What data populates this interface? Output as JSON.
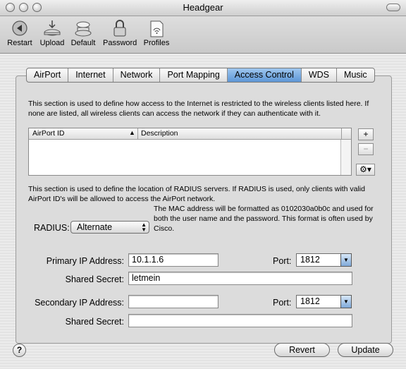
{
  "window": {
    "title": "Headgear"
  },
  "toolbar": {
    "items": [
      {
        "label": "Restart",
        "icon": "restart-icon"
      },
      {
        "label": "Upload",
        "icon": "upload-icon"
      },
      {
        "label": "Default",
        "icon": "default-icon"
      },
      {
        "label": "Password",
        "icon": "lock-icon"
      },
      {
        "label": "Profiles",
        "icon": "profiles-icon"
      }
    ]
  },
  "tabs": [
    {
      "label": "AirPort"
    },
    {
      "label": "Internet"
    },
    {
      "label": "Network"
    },
    {
      "label": "Port Mapping"
    },
    {
      "label": "Access Control",
      "active": true
    },
    {
      "label": "WDS"
    },
    {
      "label": "Music"
    }
  ],
  "access_control": {
    "description": "This section is used to define how access to the Internet is restricted to the wireless clients listed here. If none are listed, all wireless clients can access the network if they can authenticate with it.",
    "table": {
      "columns": [
        "AirPort ID",
        "Description"
      ],
      "rows": []
    },
    "add_label": "+",
    "remove_label": "−",
    "action_icon": "gear-icon"
  },
  "radius": {
    "description": "This section is used to define the location of RADIUS servers. If RADIUS is used, only clients with valid AirPort ID's will be allowed to access the AirPort network.",
    "label": "RADIUS:",
    "mode": "Alternate",
    "note": "The MAC address will be formatted as 0102030a0b0c and used for both the user name and the password. This format is often used by Cisco.",
    "primary_ip_label": "Primary IP Address:",
    "primary_ip": "10.1.1.6",
    "primary_port_label": "Port:",
    "primary_port": "1812",
    "primary_secret_label": "Shared Secret:",
    "primary_secret": "letmein",
    "secondary_ip_label": "Secondary IP Address:",
    "secondary_ip": "",
    "secondary_port_label": "Port:",
    "secondary_port": "1812",
    "secondary_secret_label": "Shared Secret:",
    "secondary_secret": ""
  },
  "footer": {
    "help_label": "?",
    "revert_label": "Revert",
    "update_label": "Update"
  }
}
